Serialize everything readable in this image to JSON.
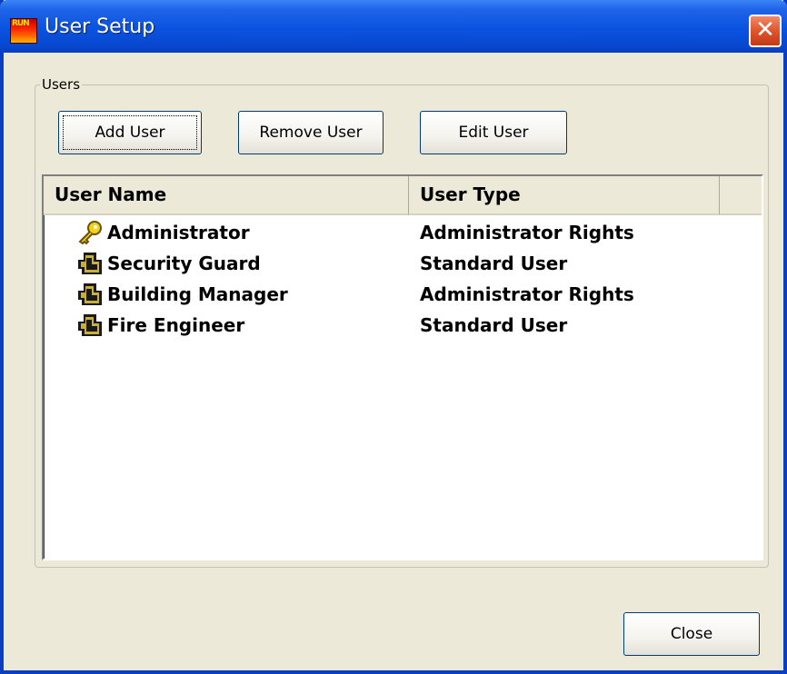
{
  "window": {
    "title": "User Setup",
    "icon_label": "RUN",
    "close_glyph": "✕"
  },
  "group": {
    "label": "Users"
  },
  "toolbar": {
    "add_label": "Add User",
    "remove_label": "Remove User",
    "edit_label": "Edit User"
  },
  "list": {
    "columns": [
      "User Name",
      "User Type"
    ],
    "rows": [
      {
        "name": "Administrator",
        "type": "Administrator Rights",
        "icon": "key-icon"
      },
      {
        "name": "Security Guard",
        "type": "Standard User",
        "icon": "user-key-icon"
      },
      {
        "name": "Building Manager",
        "type": "Administrator Rights",
        "icon": "user-key-icon"
      },
      {
        "name": "Fire Engineer",
        "type": "Standard User",
        "icon": "user-key-icon"
      }
    ]
  },
  "footer": {
    "close_label": "Close"
  },
  "colors": {
    "titlebar": "#0a53e0",
    "dialog_bg": "#ece9d8",
    "close_button": "#e0552c"
  }
}
